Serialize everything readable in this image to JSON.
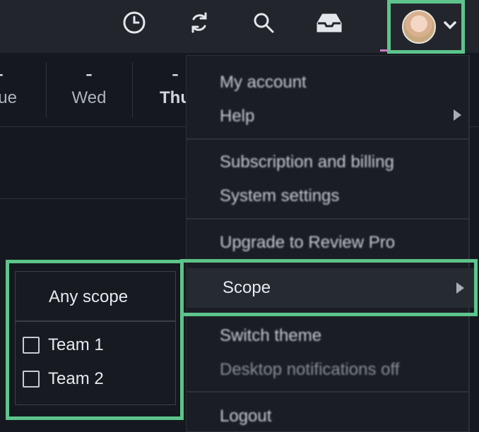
{
  "topbar": {
    "icons": [
      "clock-icon",
      "sync-icon",
      "search-icon",
      "inbox-icon"
    ],
    "avatar": "user-avatar",
    "dropdown_icon": "chevron-down-icon"
  },
  "days": [
    {
      "value": "-",
      "label": "Tue",
      "visible_label": "ue"
    },
    {
      "value": "-",
      "label": "Wed"
    },
    {
      "value": "-",
      "label": "Thu",
      "visible_label": "Thu"
    }
  ],
  "menu": {
    "my_account": "My account",
    "help": "Help",
    "subscription": "Subscription and billing",
    "system_settings": "System settings",
    "upgrade": "Upgrade to Review Pro",
    "scope": "Scope",
    "switch_theme": "Switch theme",
    "desktop_notifications": "Desktop notifications off",
    "logout": "Logout"
  },
  "scope_submenu": {
    "any": "Any scope",
    "options": [
      {
        "label": "Team 1",
        "checked": false
      },
      {
        "label": "Team 2",
        "checked": false
      }
    ]
  },
  "colors": {
    "highlight": "#5dc48b",
    "background": "#15191f",
    "topbar": "#22262c"
  }
}
